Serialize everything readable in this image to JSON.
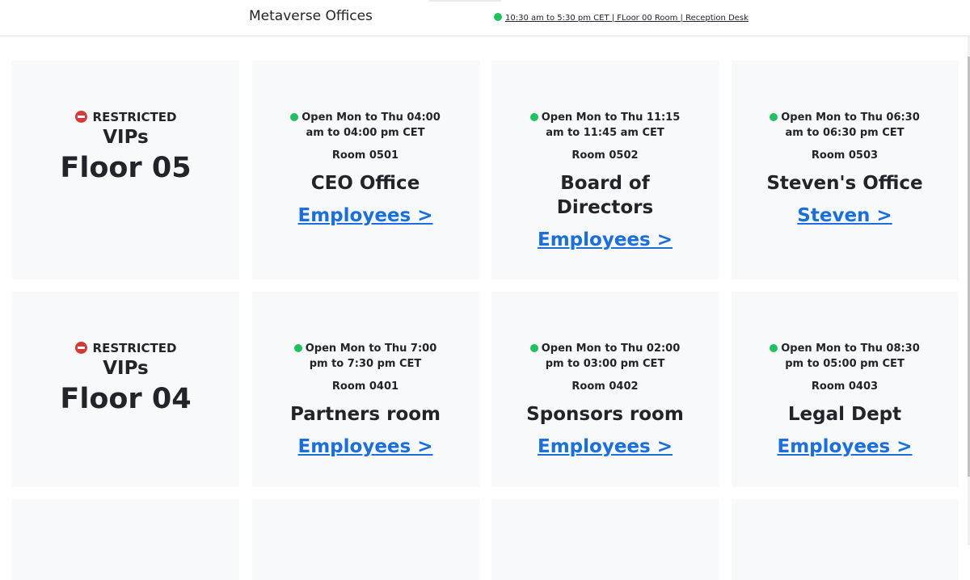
{
  "header": {
    "title": "Metaverse Offices",
    "status_text": "10:30 am to 5:30 pm CET | FLoor 00 Room | Reception Desk"
  },
  "colors": {
    "open": "#1fc25e",
    "restricted": "#d63a3a",
    "link": "#1a6fe0",
    "card_bg": "#f8f9fa"
  },
  "floors": [
    {
      "restricted_label": "RESTRICTED",
      "audience": "VIPs",
      "name": "Floor 05",
      "rooms": [
        {
          "hours": "Open Mon to Thu 04:00 am to 04:00 pm CET",
          "number": "Room 0501",
          "name": "CEO Office",
          "link": "Employees >"
        },
        {
          "hours": "Open Mon to Thu 11:15 am to 11:45 am CET",
          "number": "Room 0502",
          "name": "Board of Directors",
          "link": "Employees >"
        },
        {
          "hours": "Open Mon to Thu 06:30 am to 06:30 pm CET",
          "number": "Room 0503",
          "name": "Steven's Office",
          "link": "Steven >"
        }
      ]
    },
    {
      "restricted_label": "RESTRICTED",
      "audience": "VIPs",
      "name": "Floor 04",
      "rooms": [
        {
          "hours": "Open Mon to Thu 7:00 pm to 7:30 pm CET",
          "number": "Room 0401",
          "name": "Partners room",
          "link": "Employees >"
        },
        {
          "hours": "Open Mon to Thu 02:00 pm to 03:00 pm CET",
          "number": "Room 0402",
          "name": "Sponsors room",
          "link": "Employees >"
        },
        {
          "hours": "Open Mon to Thu 08:30 pm to 05:00 pm CET",
          "number": "Room 0403",
          "name": "Legal Dept",
          "link": "Employees >"
        }
      ]
    }
  ]
}
